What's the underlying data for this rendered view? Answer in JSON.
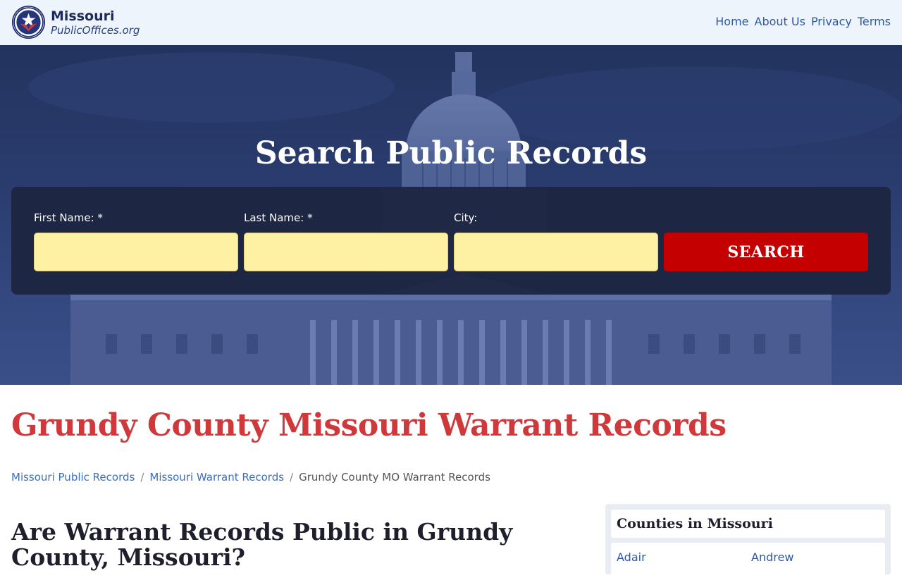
{
  "header": {
    "brand_state": "Missouri",
    "brand_site": "PublicOffices.org",
    "nav": [
      {
        "label": "Home"
      },
      {
        "label": "About Us"
      },
      {
        "label": "Privacy"
      },
      {
        "label": "Terms"
      }
    ]
  },
  "hero": {
    "title": "Search Public Records",
    "form": {
      "first_name_label": "First Name: *",
      "first_name_value": "",
      "last_name_label": "Last Name: *",
      "last_name_value": "",
      "city_label": "City:",
      "city_value": "",
      "search_button": "SEARCH"
    }
  },
  "main": {
    "title": "Grundy County Missouri Warrant Records",
    "breadcrumb": [
      {
        "label": "Missouri Public Records"
      },
      {
        "label": "Missouri Warrant Records"
      },
      {
        "label": "Grundy County MO Warrant Records"
      }
    ],
    "breadcrumb_separator": "/",
    "section_heading": "Are Warrant Records Public in Grundy County, Missouri?"
  },
  "sidebar": {
    "title": "Counties in Missouri",
    "counties": [
      "Adair",
      "Andrew"
    ]
  },
  "colors": {
    "header_bg": "#eef4fc",
    "hero_overlay": "#23335f",
    "input_bg": "#fff1a4",
    "search_button": "#c40000",
    "title_red": "#d0393b",
    "link_blue": "#2b59a6"
  }
}
